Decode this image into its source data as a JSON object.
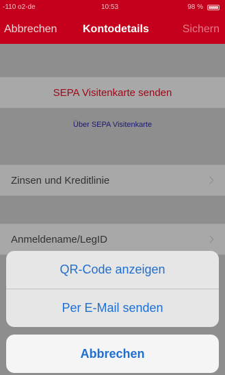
{
  "status_bar": {
    "carrier": "-110 o2-de",
    "time": "10:53",
    "battery": "98 %"
  },
  "nav_bar": {
    "cancel_label": "Abbrechen",
    "title": "Kontodetails",
    "save_label": "Sichern"
  },
  "sepa": {
    "send_label": "SEPA Visitenkarte senden",
    "info_link": "Über SEPA Visitenkarte"
  },
  "list": {
    "interest_label": "Zinsen und Kreditlinie",
    "login_label": "Anmeldename/LegID"
  },
  "action_sheet": {
    "show_qr_label": "QR-Code anzeigen",
    "send_email_label": "Per E-Mail senden",
    "cancel_label": "Abbrechen"
  },
  "colors": {
    "brand": "#c4001c",
    "action": "#1f6fd1"
  }
}
